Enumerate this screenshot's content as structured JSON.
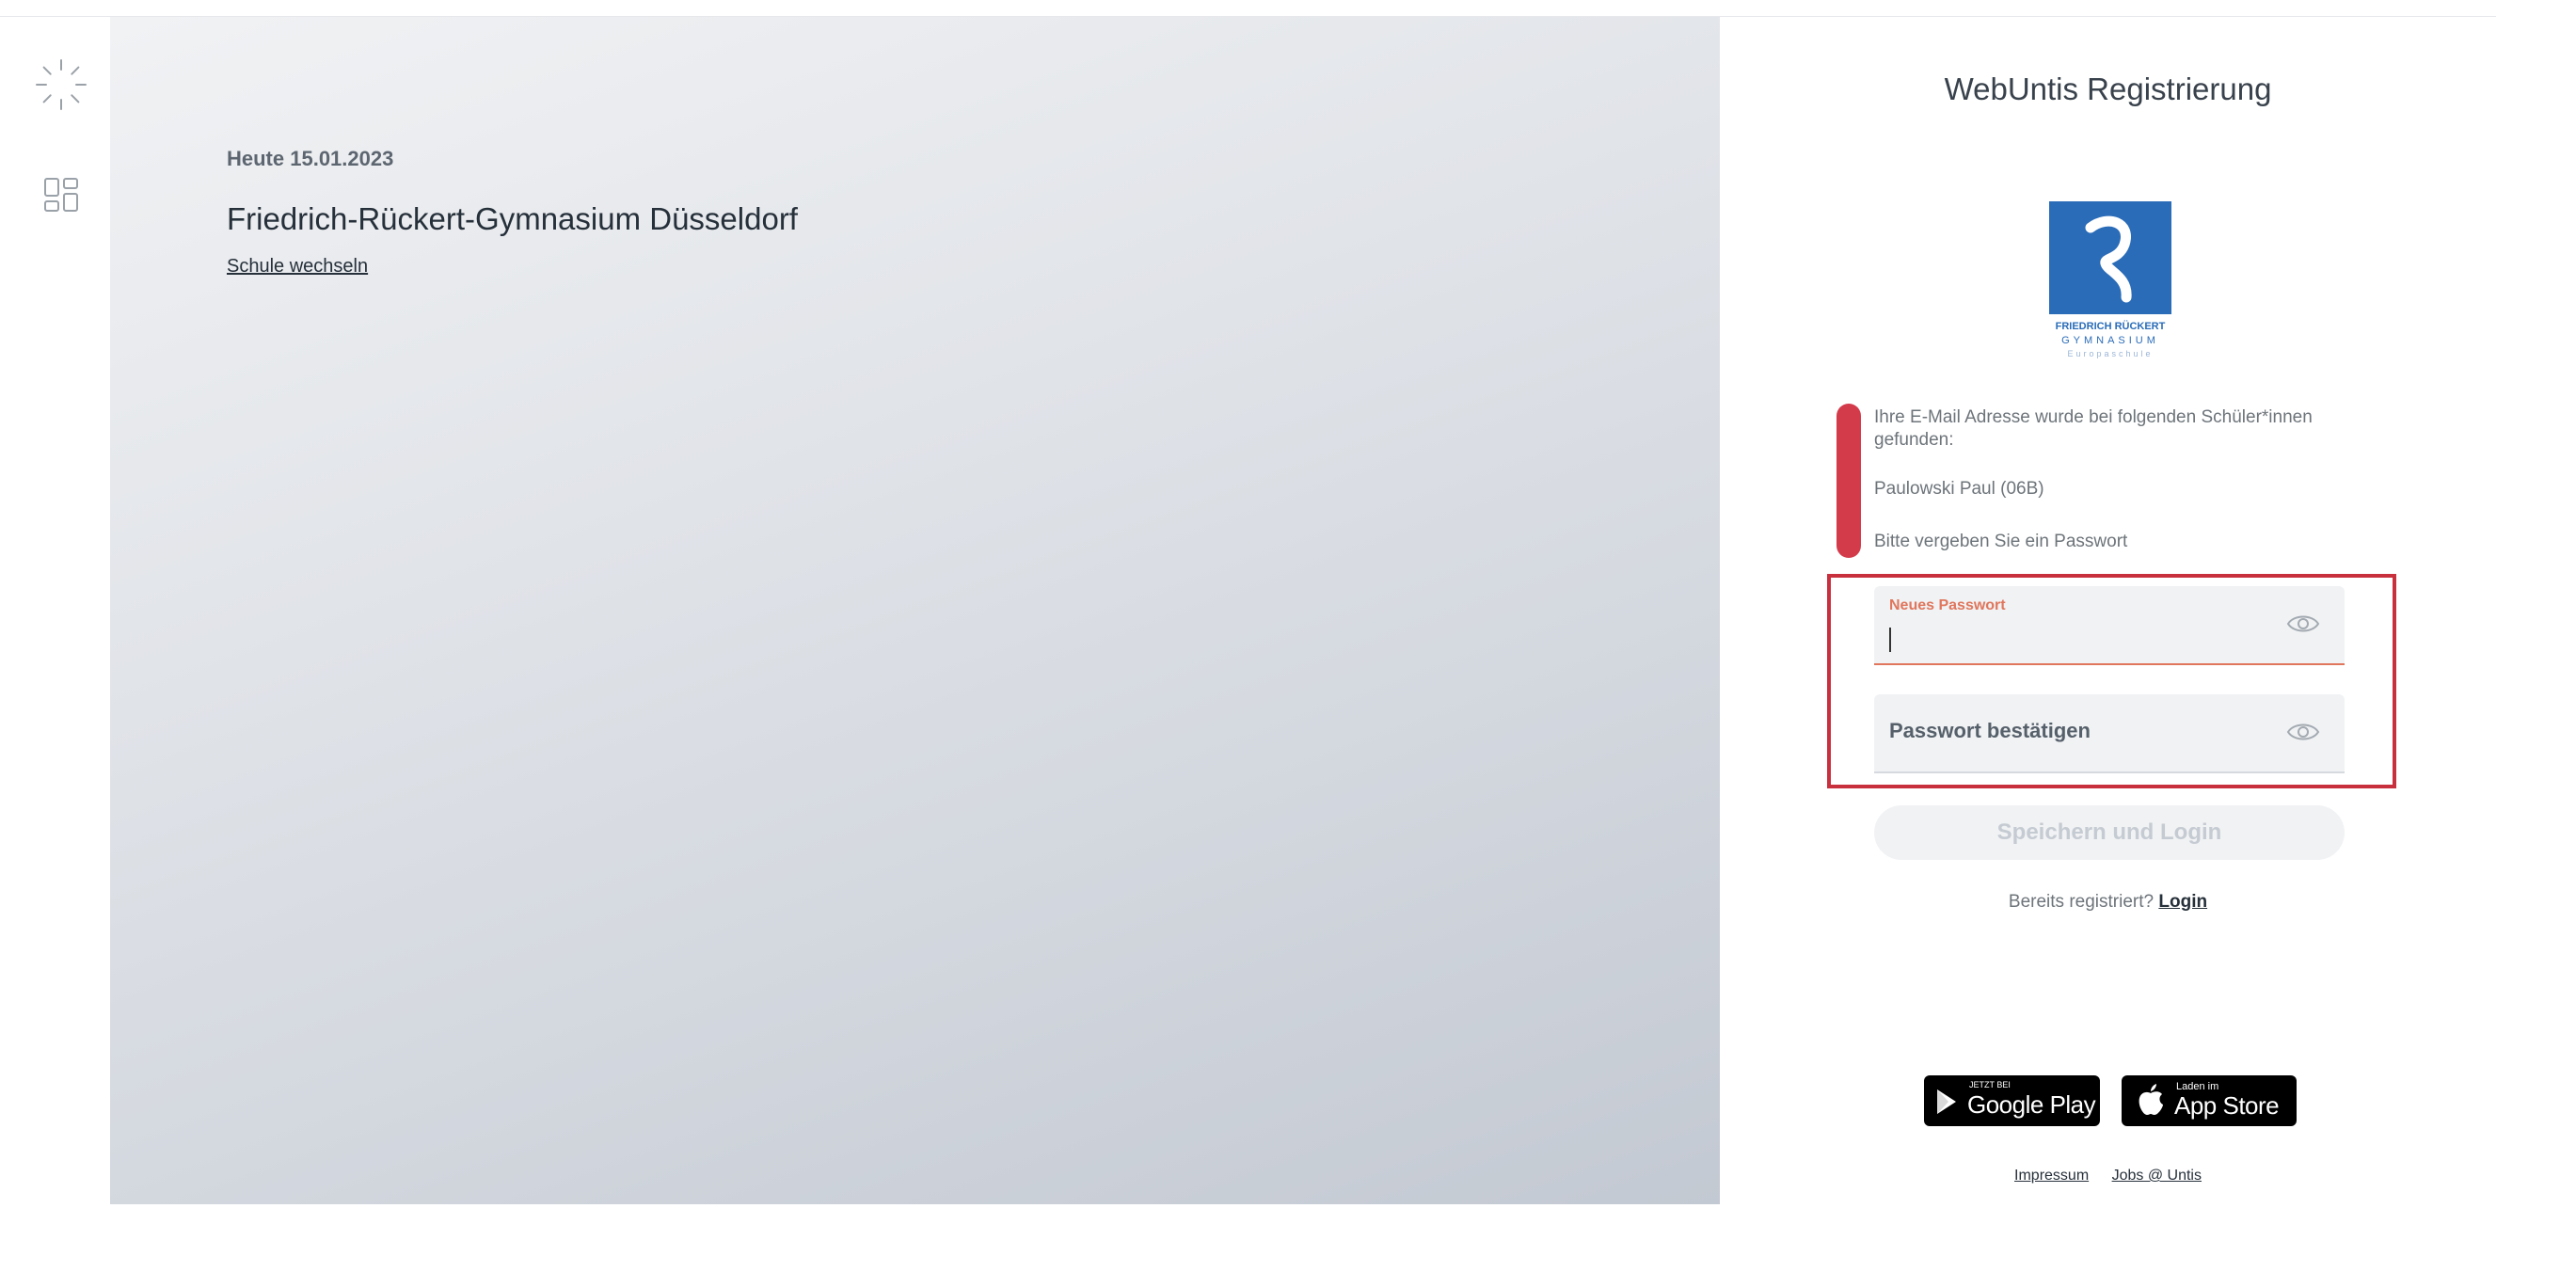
{
  "hero": {
    "date": "Heute 15.01.2023",
    "school_name": "Friedrich-Rückert-Gymnasium Düsseldorf",
    "switch_school": "Schule wechseln"
  },
  "panel": {
    "title": "WebUntis Registrierung",
    "school_logo": {
      "line1": "FRIEDRICH RÜCKERT",
      "line2": "GYMNASIUM",
      "line3": "Europaschule"
    },
    "notice": {
      "found_text": "Ihre E-Mail Adresse wurde bei folgenden Schüler*innen gefunden:",
      "student": "Paulowski Paul (06B)",
      "instruction": "Bitte vergeben Sie ein Passwort"
    },
    "new_password": {
      "label": "Neues Passwort",
      "value": ""
    },
    "confirm_password": {
      "label": "Passwort bestätigen",
      "value": ""
    },
    "save_button": "Speichern und Login",
    "already_registered": "Bereits registriert?",
    "login_link": "Login",
    "google_play": {
      "small": "JETZT BEI",
      "big": "Google Play"
    },
    "app_store": {
      "small": "Laden im",
      "big": "App Store"
    },
    "footer": {
      "impressum": "Impressum",
      "jobs": "Jobs @ Untis"
    }
  },
  "colors": {
    "accent_error": "#d33b4b",
    "field_focus": "#e0765c",
    "logo_blue": "#2a6cb8"
  },
  "icons": [
    "loading-spinner-icon",
    "apps-grid-icon",
    "eye-icon",
    "google-play-icon",
    "apple-icon"
  ]
}
